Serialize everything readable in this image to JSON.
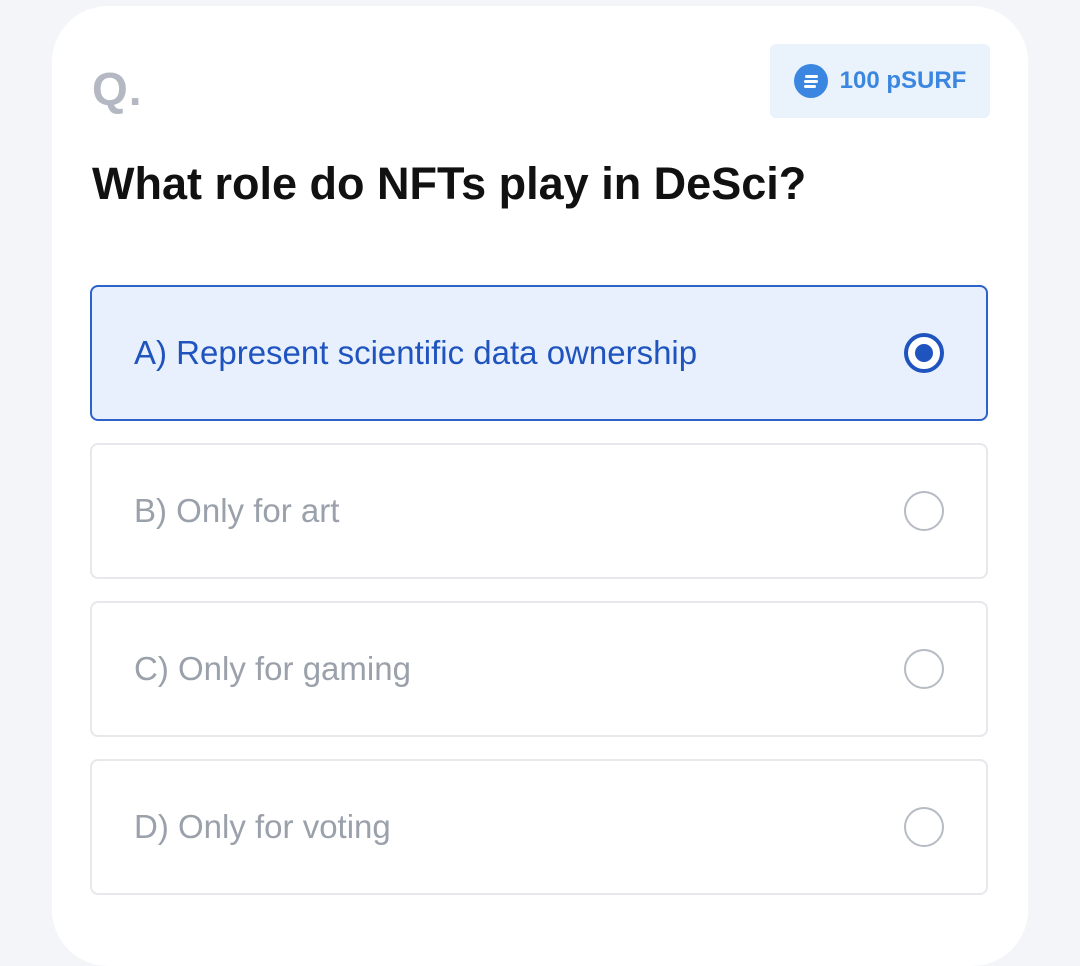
{
  "quiz": {
    "prefix": "Q.",
    "reward": {
      "icon": "coin-icon",
      "text": "100 pSURF",
      "color": "#3a86e0"
    },
    "question": "What role do NFTs play in DeSci?",
    "options": [
      {
        "label": "A) Represent scientific data ownership",
        "selected": true
      },
      {
        "label": "B) Only for art",
        "selected": false
      },
      {
        "label": "C) Only for gaming",
        "selected": false
      },
      {
        "label": "D) Only for voting",
        "selected": false
      }
    ],
    "accent_color": "#1f54bf"
  }
}
